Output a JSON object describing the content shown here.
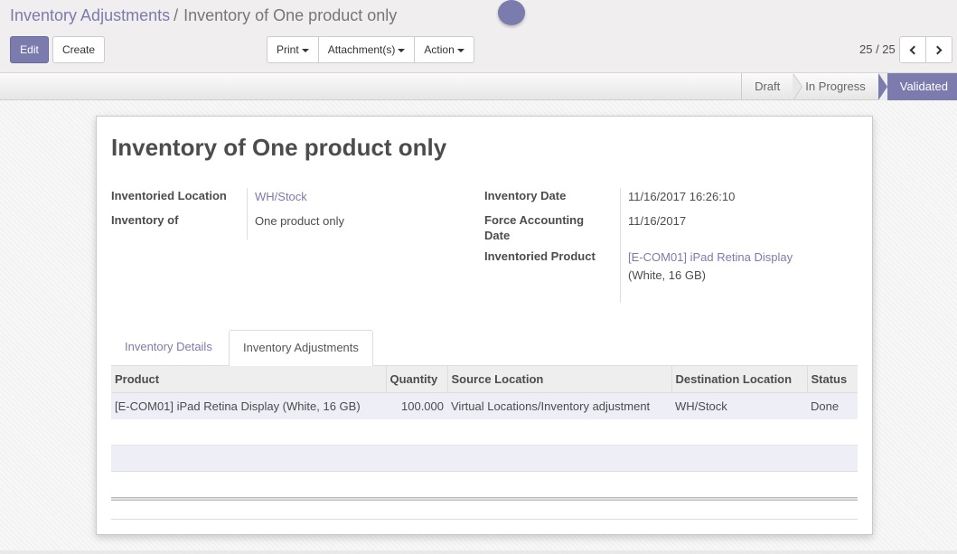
{
  "breadcrumb": {
    "parent": "Inventory Adjustments",
    "separator": "/",
    "current": "Inventory of One product only"
  },
  "buttons": {
    "edit": "Edit",
    "create": "Create",
    "print": "Print",
    "attachments": "Attachment(s)",
    "action": "Action"
  },
  "pager": {
    "value": "25 / 25"
  },
  "status": {
    "steps": [
      "Draft",
      "In Progress",
      "Validated"
    ],
    "active": "Validated"
  },
  "form": {
    "title": "Inventory of One product only",
    "left": [
      {
        "label": "Inventoried Location",
        "value": "WH/Stock"
      },
      {
        "label": "Inventory of",
        "value": "One product only"
      }
    ],
    "right": {
      "inventory_date_label": "Inventory Date",
      "inventory_date": "11/16/2017 16:26:10",
      "force_date_label_1": "Force Accounting",
      "force_date_label_2": "Date",
      "force_date": "11/16/2017",
      "product_label": "Inventoried Product",
      "product_line1": "[E-COM01] iPad Retina Display",
      "product_line2": "(White, 16 GB)"
    }
  },
  "tabs": [
    "Inventory Details",
    "Inventory Adjustments"
  ],
  "active_tab": "Inventory Adjustments",
  "table": {
    "columns": [
      "Product",
      "Quantity",
      "Source Location",
      "Destination Location",
      "Status"
    ],
    "rows": [
      {
        "product": "[E-COM01] iPad Retina Display (White, 16 GB)",
        "quantity": "100.000",
        "source": "Virtual Locations/Inventory adjustment",
        "destination": "WH/Stock",
        "status": "Done"
      }
    ]
  },
  "colors": {
    "brand": "#7c7bad",
    "link": "#7c7bad"
  }
}
